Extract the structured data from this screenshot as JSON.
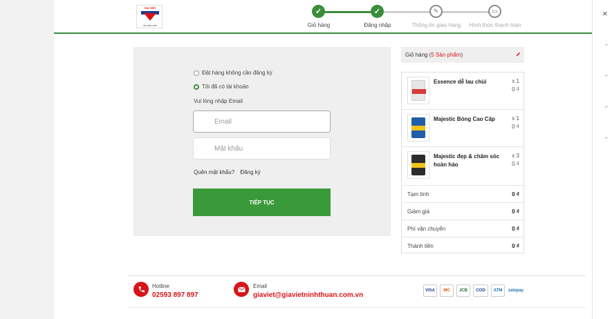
{
  "logo": {
    "brand_text": "GIA VIỆT",
    "sub_text": "ISO 9001:2015"
  },
  "steps": [
    {
      "label": "Giỏ hàng",
      "state": "done"
    },
    {
      "label": "Đăng nhập",
      "state": "done"
    },
    {
      "label": "Thông tin giao hàng",
      "state": "todo"
    },
    {
      "label": "Hình thức thanh toán",
      "state": "todo"
    }
  ],
  "login": {
    "option_guest": "Đặt hàng không cần đăng ký",
    "option_account": "Tôi đã có tài khoản",
    "email_prompt": "Vui lòng nhập Email",
    "email_placeholder": "Email",
    "password_placeholder": "Mật khẩu",
    "forgot_link": "Quên mật khẩu?",
    "register_link": "Đăng ký",
    "continue_button": "TIẾP TỤC"
  },
  "cart": {
    "title_prefix": "Giỏ hàng (",
    "count_text": "5 Sản phẩm",
    "title_suffix": ")",
    "items": [
      {
        "name": "Essence dễ lau chùi",
        "qty": "x 1",
        "price": "0 ₫",
        "can_color": "#e8e8e8"
      },
      {
        "name": "Majestic Bóng Cao Cấp",
        "qty": "x 1",
        "price": "0 ₫",
        "can_color": "#1f5fa8"
      },
      {
        "name": "Majestic đẹp & chăm sóc hoàn hảo",
        "qty": "x 3",
        "price": "0 ₫",
        "can_color": "#2b2b2b"
      }
    ],
    "summary": [
      {
        "label": "Tạm tính",
        "value": "0 ₫"
      },
      {
        "label": "Giảm giá",
        "value": "0 ₫"
      },
      {
        "label": "Phí vận chuyển",
        "value": "0 ₫"
      },
      {
        "label": "Thành tiền",
        "value": "0 ₫"
      }
    ]
  },
  "footer": {
    "hotline_label": "Hotline",
    "hotline_value": "02593 897 897",
    "email_label": "Email",
    "email_value": "giaviet@giavietninhthuan.com.vn",
    "payments": [
      "VISA",
      "MC",
      "JCB",
      "COD",
      "ATM",
      "zalopay"
    ]
  },
  "colors": {
    "accent": "#3a8e3a",
    "brand_red": "#d7141a"
  }
}
